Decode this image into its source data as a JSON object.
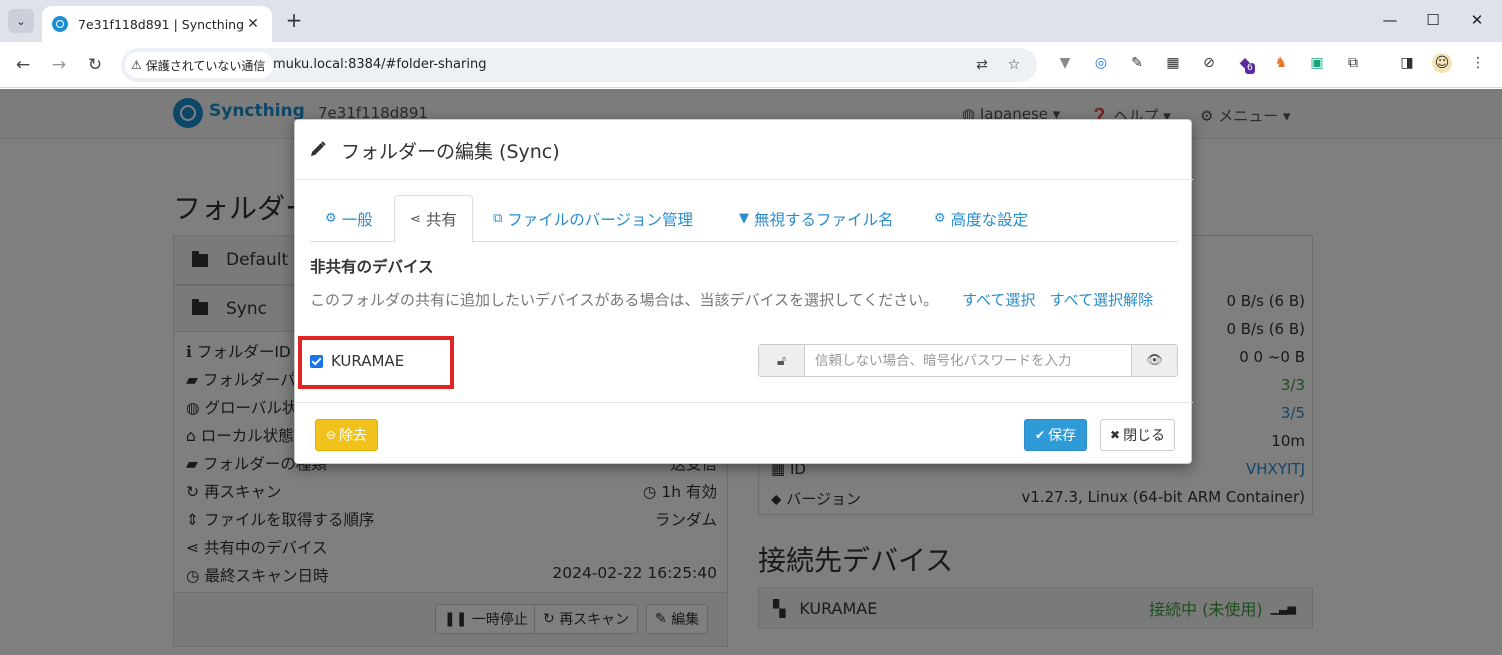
{
  "browser": {
    "tab_title": "7e31f118d891 | Syncthing",
    "security_label": "保護されていない通信",
    "url": "muku.local:8384/#folder-sharing",
    "extension_badge": "6"
  },
  "app": {
    "brand": "Syncthing",
    "device_name": "7e31f118d891",
    "nav": {
      "language": "Japanese",
      "help": "ヘルプ",
      "menu": "メニュー"
    }
  },
  "folders": {
    "heading": "フォルダー",
    "default_folder": "Default",
    "sync_folder": "Sync",
    "rows": [
      {
        "label": "フォルダーID",
        "value": ""
      },
      {
        "label": "フォルダーパス",
        "value": ""
      },
      {
        "label": "グローバル状態",
        "value": ""
      },
      {
        "label": "ローカル状態",
        "value": ""
      },
      {
        "label": "フォルダーの種類",
        "value": "送受信"
      },
      {
        "label": "再スキャン",
        "value": "1h  有効"
      },
      {
        "label": "ファイルを取得する順序",
        "value": "ランダム"
      },
      {
        "label": "共有中のデバイス",
        "value": ""
      },
      {
        "label": "最終スキャン日時",
        "value": "2024-02-22 16:25:40"
      }
    ],
    "buttons": {
      "pause": "一時停止",
      "rescan": "再スキャン",
      "edit": "編集"
    }
  },
  "this_device": {
    "rows": [
      {
        "label": "",
        "value": "0 B/s (6 B)"
      },
      {
        "label": "",
        "value": "0 B/s (6 B)"
      },
      {
        "label": "",
        "value": "0   0   ~0 B"
      },
      {
        "label": "",
        "value": "3/3"
      },
      {
        "label": "",
        "value": "3/5"
      },
      {
        "label": "",
        "value": "10m"
      },
      {
        "label": "ID",
        "value": "VHXYITJ"
      },
      {
        "label": "バージョン",
        "value": "v1.27.3, Linux (64-bit ARM Container)"
      }
    ]
  },
  "remote": {
    "heading": "接続先デバイス",
    "device": "KURAMAE",
    "status": "接続中 (未使用)"
  },
  "modal": {
    "title": "フォルダーの編集 (Sync)",
    "tabs": [
      {
        "label": "一般",
        "icon": "gear-icon"
      },
      {
        "label": "共有",
        "icon": "share-icon"
      },
      {
        "label": "ファイルのバージョン管理",
        "icon": "copy-icon"
      },
      {
        "label": "無視するファイル名",
        "icon": "filter-icon"
      },
      {
        "label": "高度な設定",
        "icon": "cogs-icon"
      }
    ],
    "active_tab": "共有",
    "section_title": "非共有のデバイス",
    "help_text": "このフォルダの共有に追加したいデバイスがある場合は、当該デバイスを選択してください。",
    "select_all": "すべて選択",
    "deselect_all": "すべて選択解除",
    "device_label": "KURAMAE",
    "device_checked": true,
    "password_placeholder": "信頼しない場合、暗号化パスワードを入力",
    "buttons": {
      "remove": "除去",
      "save": "保存",
      "close": "閉じる"
    }
  },
  "colors": {
    "syncthing_blue": "#1b8fcf",
    "link": "#2a8ccc",
    "warning": "#f0c21b",
    "primary": "#2e9ad6",
    "highlight": "#e02424",
    "connected": "#3c9c3c"
  }
}
